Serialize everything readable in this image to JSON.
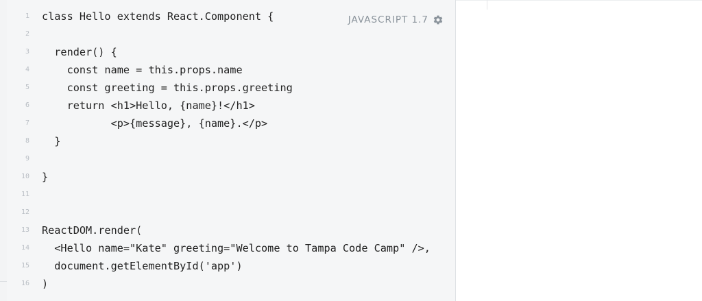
{
  "editor": {
    "language": "JAVASCRIPT 1.7",
    "settings_icon": "gear-icon",
    "lines": [
      {
        "n": "1",
        "text": "class Hello extends React.Component {"
      },
      {
        "n": "2",
        "text": ""
      },
      {
        "n": "3",
        "text": "  render() {"
      },
      {
        "n": "4",
        "text": "    const name = this.props.name"
      },
      {
        "n": "5",
        "text": "    const greeting = this.props.greeting"
      },
      {
        "n": "6",
        "text": "    return <h1>Hello, {name}!</h1>"
      },
      {
        "n": "7",
        "text": "           <p>{message}, {name}.</p>"
      },
      {
        "n": "8",
        "text": "  }"
      },
      {
        "n": "9",
        "text": ""
      },
      {
        "n": "10",
        "text": "}"
      },
      {
        "n": "11",
        "text": ""
      },
      {
        "n": "12",
        "text": ""
      },
      {
        "n": "13",
        "text": "ReactDOM.render("
      },
      {
        "n": "14",
        "text": "  <Hello name=\"Kate\" greeting=\"Welcome to Tampa Code Camp\" />,"
      },
      {
        "n": "15",
        "text": "  document.getElementById('app')"
      },
      {
        "n": "16",
        "text": ")"
      }
    ]
  }
}
